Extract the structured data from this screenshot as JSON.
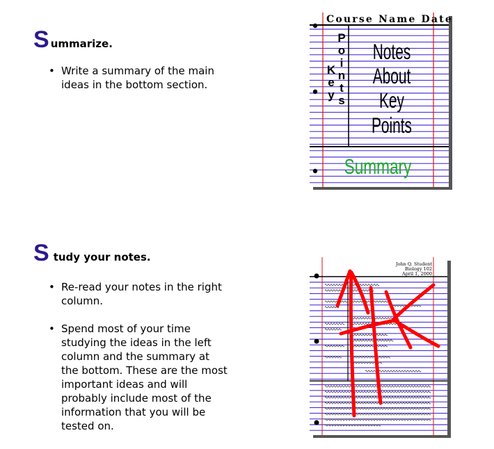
{
  "colors": {
    "accent_purple": "#2c1a8c",
    "summary_green": "#1faa2a",
    "rule_blue": "#2200cc",
    "margin_red": "#e01010",
    "mark_red": "#ff0000"
  },
  "summarize": {
    "initial": "S",
    "rest": "ummarize.",
    "bullets": [
      "Write a summary of the main ideas in the bottom section."
    ]
  },
  "study": {
    "initial": "S",
    "rest": "tudy your notes.",
    "bullets": [
      "Re-read your notes in the right column.",
      "Spend most of your time studying the ideas in the left column and the summary at the bottom. These are the most important ideas and will probably include most of the information that you will be tested on."
    ]
  },
  "notes_diagram": {
    "header": "Course Name Date",
    "left_column": "Key Points",
    "right_column": "Notes About Key Points",
    "summary": "Summary"
  },
  "study_sheet": {
    "student_name": "John Q. Student",
    "course": "Biology 102",
    "date": "April 1, 2000"
  }
}
